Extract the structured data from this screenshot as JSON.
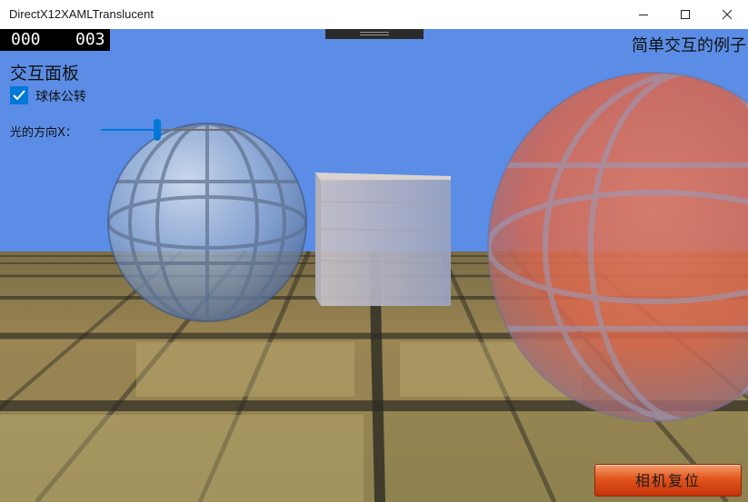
{
  "window": {
    "title": "DirectX12XAMLTranslucent",
    "controls": {
      "minimize": "minimize-icon",
      "maximize": "maximize-icon",
      "close": "close-icon"
    }
  },
  "counter": {
    "fps": "000",
    "frames": "003"
  },
  "scene": {
    "title": "简单交互的例子",
    "colors": {
      "sky": "#5b8de6",
      "floor": "#8d7a4b",
      "sphere_left": "#9fb5d4",
      "cube": "#c8c0c4",
      "sphere_right": "#e0674f"
    }
  },
  "panel": {
    "title": "交互面板",
    "orbit_checkbox": {
      "label": "球体公转",
      "checked": true
    },
    "light_slider": {
      "label": "光的方向X：",
      "value": 0.41
    }
  },
  "reset_button": {
    "label": "相机复位"
  },
  "colors": {
    "accent": "#0078d7",
    "button": "#e2561c"
  }
}
